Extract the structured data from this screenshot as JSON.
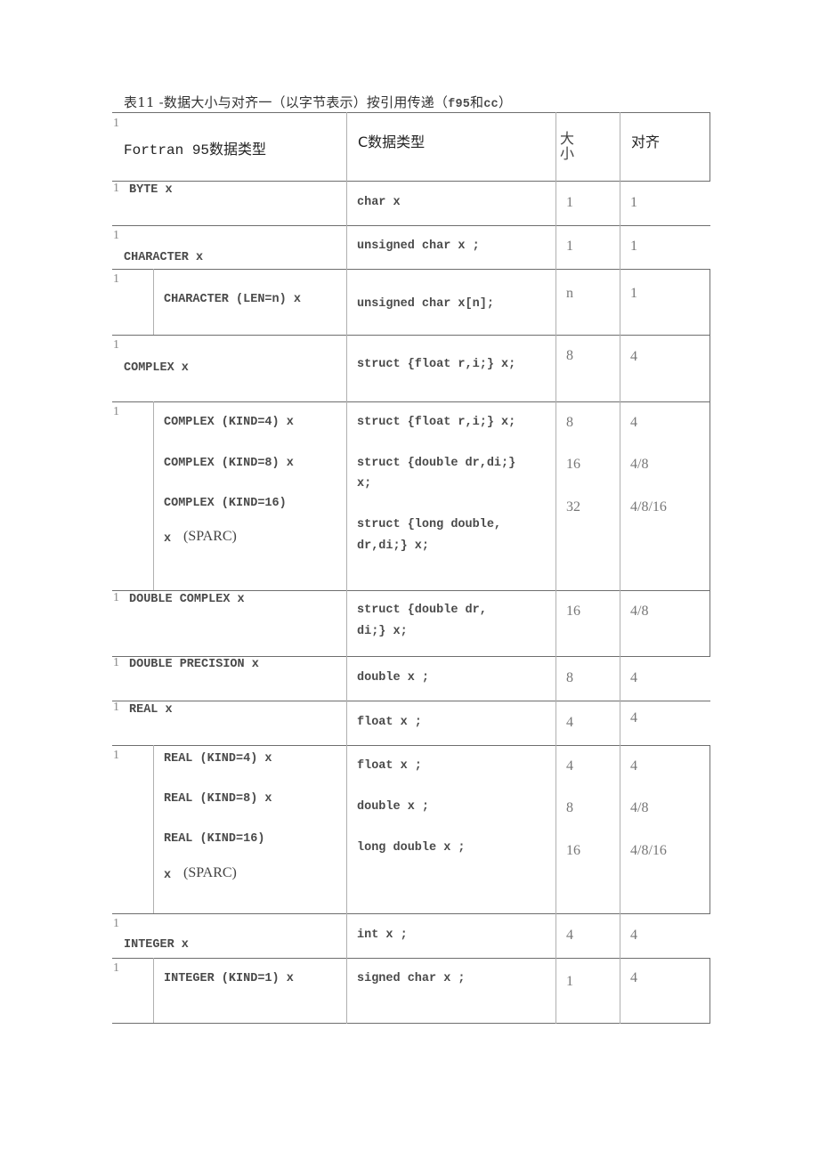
{
  "caption": {
    "prefix": "表11 -数据大小与对齐一（以字节表示）按引用传递（",
    "f95": "f95",
    "and": "和",
    "cc": "cc",
    "suffix": "）"
  },
  "table": {
    "headers": {
      "marker": "1",
      "fortran": "Fortran 95数据类型",
      "c": "C数据类型",
      "size": "大小",
      "align": "对齐"
    },
    "rows": [
      {
        "marker": "1",
        "fortran": [
          "BYTE x"
        ],
        "c": [
          "char x"
        ],
        "size": [
          "1"
        ],
        "align": [
          "1"
        ]
      },
      {
        "marker": "1",
        "fortran": [
          "CHARACTER x"
        ],
        "c": [
          "unsigned char x ;"
        ],
        "size": [
          "1"
        ],
        "align": [
          "1"
        ]
      },
      {
        "marker": "1",
        "fortran": [
          "CHARACTER (LEN=n) x"
        ],
        "c": [
          "unsigned char x[n];"
        ],
        "size": [
          "n"
        ],
        "align": [
          "1"
        ]
      },
      {
        "marker": "1",
        "fortran": [
          "COMPLEX x"
        ],
        "c": [
          "struct {float r,i;} x;"
        ],
        "size": [
          "8"
        ],
        "align": [
          "4"
        ]
      },
      {
        "marker": "1",
        "fortran": [
          "COMPLEX (KIND=4) x",
          "COMPLEX (KIND=8) x",
          "COMPLEX (KIND=16)",
          "x",
          "(SPARC)"
        ],
        "c": [
          "struct {float r,i;} x;",
          "struct {double dr,di;}",
          "x;",
          "struct {long double,",
          "dr,di;} x;"
        ],
        "size": [
          "8",
          "16",
          "32"
        ],
        "align": [
          "4",
          "4/8",
          "4/8/16"
        ]
      },
      {
        "marker": "1",
        "fortran": [
          "DOUBLE COMPLEX x"
        ],
        "c": [
          "struct {double dr,",
          "di;} x;"
        ],
        "size": [
          "16"
        ],
        "align": [
          "4/8"
        ]
      },
      {
        "marker": "1",
        "fortran": [
          "DOUBLE PRECISION x"
        ],
        "c": [
          "double x ;"
        ],
        "size": [
          "8"
        ],
        "align": [
          "4"
        ]
      },
      {
        "marker": "1",
        "fortran": [
          "REAL x"
        ],
        "c": [
          "float x ;"
        ],
        "size": [
          "4"
        ],
        "align": [
          "4"
        ]
      },
      {
        "marker": "1",
        "fortran": [
          "REAL (KIND=4) x",
          "REAL (KIND=8) x",
          "REAL (KIND=16)",
          "x",
          "(SPARC)"
        ],
        "c": [
          "float x ;",
          "double x ;",
          "long double x ;"
        ],
        "size": [
          "4",
          "8",
          "16"
        ],
        "align": [
          "4",
          "4/8",
          "4/8/16"
        ]
      },
      {
        "marker": "1",
        "fortran": [
          "INTEGER x"
        ],
        "c": [
          "int x ;"
        ],
        "size": [
          "4"
        ],
        "align": [
          "4"
        ]
      },
      {
        "marker": "1",
        "fortran": [
          "INTEGER (KIND=1) x"
        ],
        "c": [
          "signed char x ;"
        ],
        "size": [
          "1"
        ],
        "align": [
          "4"
        ]
      }
    ]
  }
}
